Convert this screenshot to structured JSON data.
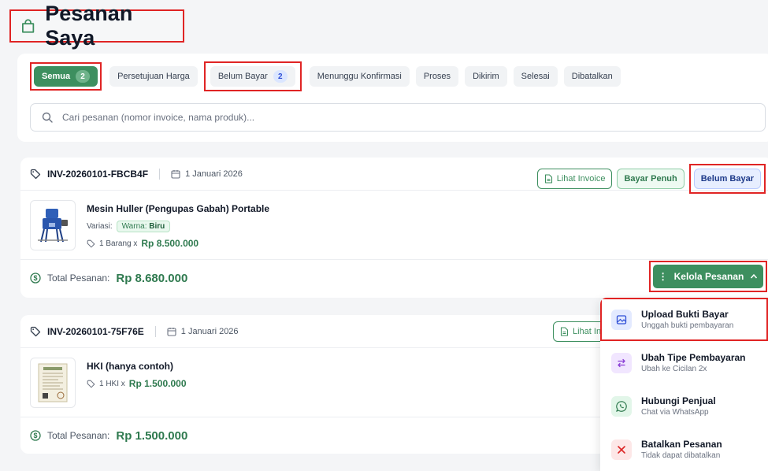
{
  "page": {
    "title": "Pesanan Saya"
  },
  "tabs": [
    {
      "label": "Semua",
      "count": "2"
    },
    {
      "label": "Persetujuan Harga"
    },
    {
      "label": "Belum Bayar",
      "count": "2"
    },
    {
      "label": "Menunggu Konfirmasi"
    },
    {
      "label": "Proses"
    },
    {
      "label": "Dikirim"
    },
    {
      "label": "Selesai"
    },
    {
      "label": "Dibatalkan"
    }
  ],
  "search": {
    "placeholder": "Cari pesanan (nomor invoice, nama produk)..."
  },
  "orders": [
    {
      "invoice": "INV-20260101-FBCB4F",
      "date": "1 Januari 2026",
      "view_invoice_label": "Lihat Invoice",
      "payment_type": "Bayar Penuh",
      "status": "Belum Bayar",
      "product_name": "Mesin Huller (Pengupas Gabah) Portable",
      "variant_label": "Variasi:",
      "variant_key": "Warna:",
      "variant_value": "Biru",
      "qty_text": "1 Barang x",
      "price": "Rp 8.500.000",
      "total_label": "Total Pesanan:",
      "total": "Rp 8.680.000",
      "manage_label": "Kelola Pesanan"
    },
    {
      "invoice": "INV-20260101-75F76E",
      "date": "1 Januari 2026",
      "view_invoice_label": "Lihat In",
      "product_name": "HKI (hanya contoh)",
      "qty_text": "1 HKI x",
      "price": "Rp 1.500.000",
      "total_label": "Total Pesanan:",
      "total": "Rp 1.500.000"
    }
  ],
  "manage_menu": [
    {
      "title": "Upload Bukti Bayar",
      "subtitle": "Unggah bukti pembayaran",
      "icon": "image-icon",
      "color": "#2f4fd6",
      "bg": "#e3eaff"
    },
    {
      "title": "Ubah Tipe Pembayaran",
      "subtitle": "Ubah ke Cicilan 2x",
      "icon": "swap-icon",
      "color": "#8b3fd6",
      "bg": "#f1e6ff"
    },
    {
      "title": "Hubungi Penjual",
      "subtitle": "Chat via WhatsApp",
      "icon": "whatsapp-icon",
      "color": "#2f7a4f",
      "bg": "#e2f6e9"
    },
    {
      "title": "Batalkan Pesanan",
      "subtitle": "Tidak dapat dibatalkan",
      "icon": "close-icon",
      "color": "#dc2626",
      "bg": "#fde7e7"
    }
  ],
  "colors": {
    "accent": "#3d8f5f",
    "highlight": "#e02424",
    "status_blue": "#e7eeff"
  }
}
